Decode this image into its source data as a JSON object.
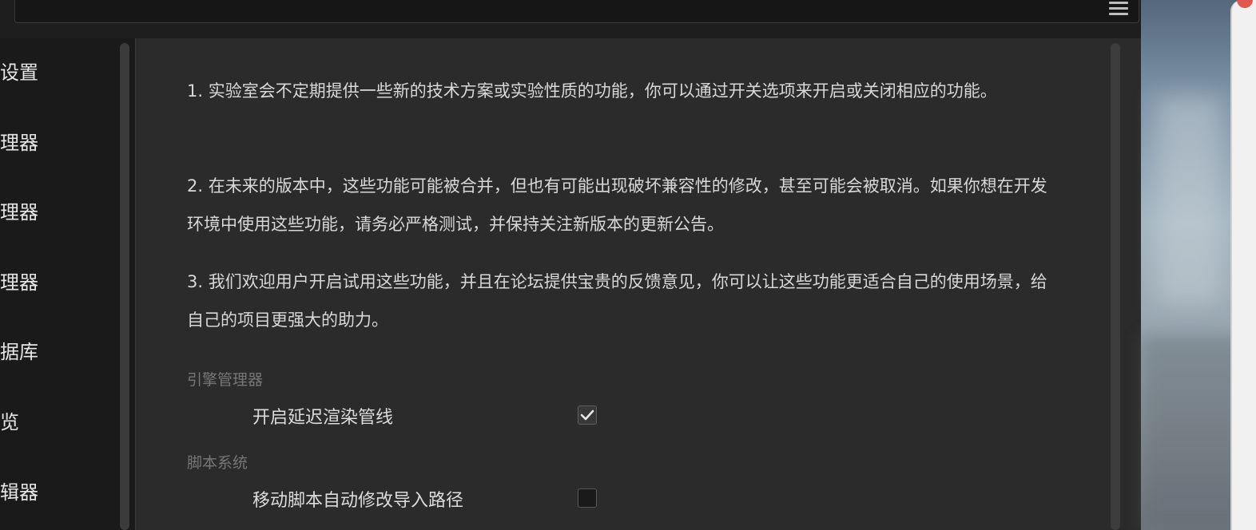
{
  "sidebar": {
    "items": [
      {
        "label": "设置"
      },
      {
        "label": "管理器"
      },
      {
        "label": "管理器"
      },
      {
        "label": "管理器"
      },
      {
        "label": "数据库"
      },
      {
        "label": "览"
      },
      {
        "label": "编辑器"
      }
    ]
  },
  "main": {
    "paragraphs": [
      "1. 实验室会不定期提供一些新的技术方案或实验性质的功能，你可以通过开关选项来开启或关闭相应的功能。",
      "2. 在未来的版本中，这些功能可能被合并，但也有可能出现破坏兼容性的修改，甚至可能会被取消。如果你想在开发环境中使用这些功能，请务必严格测试，并保持关注新版本的更新公告。",
      "3. 我们欢迎用户开启试用这些功能，并且在论坛提供宝贵的反馈意见，你可以让这些功能更适合自己的使用场景，给自己的项目更强大的助力。"
    ],
    "sections": [
      {
        "title": "引擎管理器",
        "option": {
          "label": "开启延迟渲染管线",
          "checked": true
        }
      },
      {
        "title": "脚本系统",
        "option": {
          "label": "移动脚本自动修改导入路径",
          "checked": false
        }
      }
    ]
  },
  "icons": {
    "menu": "hamburger-menu-icon",
    "check": "checkmark-icon"
  },
  "colors": {
    "background": "#2b2b2b",
    "sidebar": "#1a1a1a",
    "section_title": "#767676",
    "text": "#d8d8d8"
  }
}
